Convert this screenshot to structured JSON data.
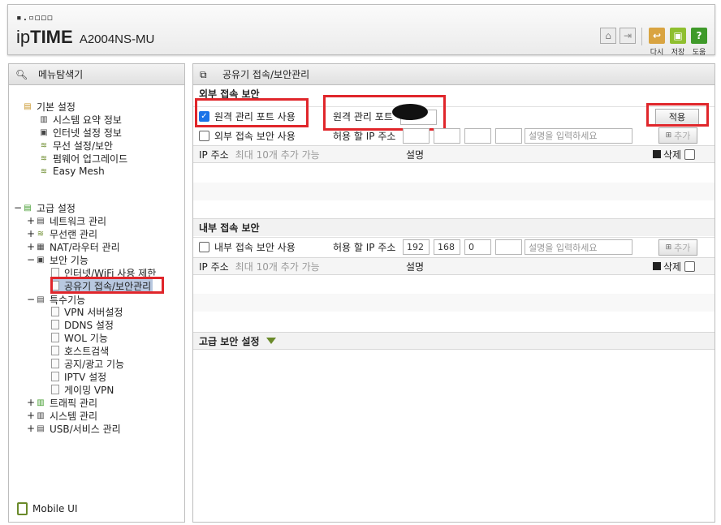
{
  "header": {
    "logo_dots": "▪.▫◻◻◻",
    "logo_ip": "ip",
    "logo_time": "TIME",
    "model": "A2004NS-MU",
    "buttons": [
      {
        "label": "다시"
      },
      {
        "label": "저장"
      },
      {
        "label": "도움"
      }
    ]
  },
  "sidebar": {
    "title": "메뉴탐색기",
    "basic": {
      "label": "기본 설정",
      "items": [
        "시스템 요약 정보",
        "인터넷 설정 정보",
        "무선 설정/보안",
        "펌웨어 업그레이드",
        "Easy Mesh"
      ]
    },
    "advanced": {
      "label": "고급 설정",
      "items": [
        {
          "label": "네트워크 관리",
          "toggle": "+"
        },
        {
          "label": "무선랜 관리",
          "toggle": "+"
        },
        {
          "label": "NAT/라우터 관리",
          "toggle": "+"
        },
        {
          "label": "보안 기능",
          "toggle": "−"
        }
      ],
      "security_items": [
        "인터넷/WiFi 사용 제한",
        "공유기 접속/보안관리"
      ],
      "special": {
        "label": "특수기능",
        "toggle": "−"
      },
      "special_items": [
        "VPN 서버설정",
        "DDNS 설정",
        "WOL 기능",
        "호스트검색",
        "공지/광고 기능",
        "IPTV 설정",
        "게이밍 VPN"
      ],
      "tail": [
        {
          "label": "트래픽 관리",
          "toggle": "+"
        },
        {
          "label": "시스템 관리",
          "toggle": "+"
        },
        {
          "label": "USB/서비스 관리",
          "toggle": "+"
        }
      ]
    },
    "mobile_ui": "Mobile UI"
  },
  "main": {
    "title": "공유기 접속/보안관리",
    "external": {
      "heading": "외부 접속 보안",
      "remote_port_checkbox": "원격 관리 포트 사용",
      "remote_port_label": "원격 관리 포트",
      "remote_port_value": "",
      "apply_button": "적용",
      "allow_checkbox": "외부 접속 보안 사용",
      "allow_ip_label": "허용 할 IP 주소",
      "desc_placeholder": "설명을 입력하세요",
      "add_button": "추가",
      "grid": {
        "ip_header": "IP 주소",
        "ip_hint": "최대 10개 추가 가능",
        "desc_header": "설명",
        "delete_label": "삭제"
      }
    },
    "internal": {
      "heading": "내부 접속 보안",
      "checkbox": "내부 접속 보안 사용",
      "allow_ip_label": "허용 할 IP 주소",
      "ip": [
        "192",
        "168",
        "0",
        ""
      ],
      "desc_placeholder": "설명을 입력하세요",
      "add_button": "추가",
      "grid": {
        "ip_header": "IP 주소",
        "ip_hint": "최대 10개 추가 가능",
        "desc_header": "설명",
        "delete_label": "삭제"
      }
    },
    "advanced": {
      "heading": "고급 보안 설정"
    }
  },
  "colors": {
    "highlight_red": "#e0262b",
    "accent_green": "#6a8a2a",
    "selection": "#b8c8e0"
  }
}
